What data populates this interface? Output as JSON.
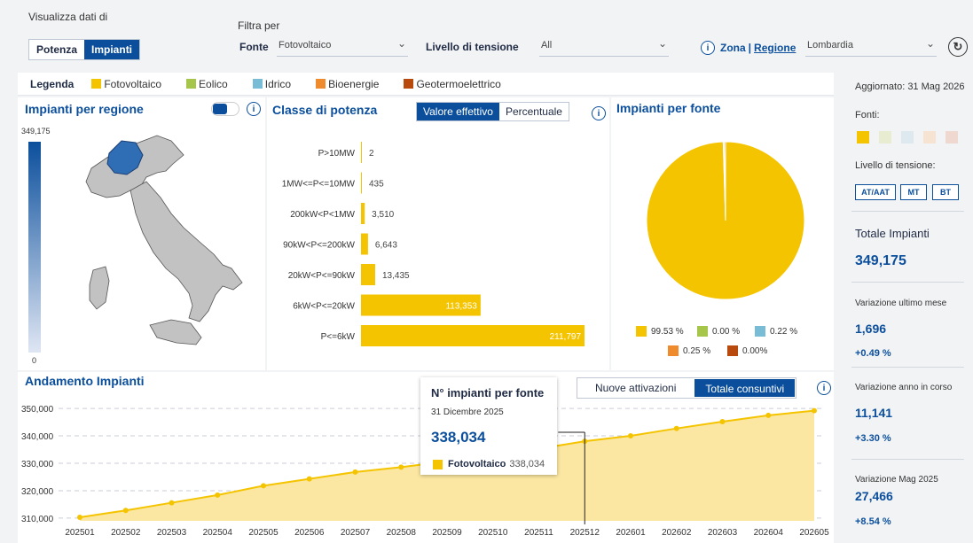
{
  "topbar": {
    "view_label": "Visualizza dati di",
    "view_options": [
      "Potenza",
      "Impianti"
    ],
    "filter_label": "Filtra per",
    "fonte_label": "Fonte",
    "fonte_value": "Fotovoltaico",
    "tensione_label": "Livello di tensione",
    "tensione_value": "All",
    "zona_label": "Zona",
    "regione_label": "Regione",
    "regione_value": "Lombardia"
  },
  "legend": {
    "title": "Legenda",
    "items": [
      {
        "label": "Fotovoltaico",
        "color": "#f5c400"
      },
      {
        "label": "Eolico",
        "color": "#a6c64b"
      },
      {
        "label": "Idrico",
        "color": "#79bcd6"
      },
      {
        "label": "Bioenergie",
        "color": "#ef8b2c"
      },
      {
        "label": "Geotermoelettrico",
        "color": "#b84a0e"
      }
    ]
  },
  "map_panel": {
    "title": "Impianti per regione",
    "scale_max": "349,175",
    "scale_min": "0"
  },
  "power_panel": {
    "title": "Classe di potenza",
    "toggle": [
      "Valore effettivo",
      "Percentuale"
    ]
  },
  "source_panel": {
    "title": "Impianti per fonte",
    "legend": [
      "99.53 %",
      "0.00 %",
      "0.22 %",
      "0.25 %",
      "0.00%"
    ]
  },
  "trend_panel": {
    "title": "Andamento Impianti",
    "toggle": [
      "Nuove attivazioni",
      "Totale consuntivi"
    ]
  },
  "tooltip": {
    "title": "N° impianti per fonte",
    "date": "31 Dicembre 2025",
    "value": "338,034",
    "series_label": "Fotovoltaico",
    "series_value": "338,034"
  },
  "sidebar": {
    "updated": "Aggiornato: 31 Mag 2026",
    "fonti_label": "Fonti:",
    "fonti_colors": [
      "#f5c400",
      "#e8ecd0",
      "#dde9ee",
      "#f7e3d2",
      "#eed8d0"
    ],
    "tensione_label": "Livello di tensione:",
    "tensione_buttons": [
      "AT/AAT",
      "MT",
      "BT"
    ],
    "total_label": "Totale Impianti",
    "total_value": "349,175",
    "month_label": "Variazione ultimo mese",
    "month_value": "1,696",
    "month_pct": "+0.49 %",
    "year_label": "Variazione anno in corso",
    "year_value": "11,141",
    "year_pct": "+3.30 %",
    "yoy_label": "Variazione Mag 2025",
    "yoy_value": "27,466",
    "yoy_pct": "+8.54 %"
  },
  "chart_data": [
    {
      "type": "bar",
      "orientation": "horizontal",
      "categories": [
        "P>10MW",
        "1MW<=P<=10MW",
        "200kW<P<1MW",
        "90kW<P<=200kW",
        "20kW<P<=90kW",
        "6kW<P<=20kW",
        "P<=6kW"
      ],
      "values": [
        2,
        435,
        3510,
        6643,
        13435,
        113353,
        211797
      ],
      "value_labels": [
        "2",
        "435",
        "3,510",
        "6,643",
        "13,435",
        "113,353",
        "211,797"
      ],
      "color": "#f5c400"
    },
    {
      "type": "pie",
      "labels": [
        "Fotovoltaico",
        "Eolico",
        "Idrico",
        "Bioenergie",
        "Geotermoelettrico"
      ],
      "values": [
        99.53,
        0.0,
        0.22,
        0.25,
        0.0
      ],
      "colors": [
        "#f5c400",
        "#a6c64b",
        "#79bcd6",
        "#ef8b2c",
        "#b84a0e"
      ]
    },
    {
      "type": "area",
      "x": [
        "202501",
        "202502",
        "202503",
        "202504",
        "202505",
        "202506",
        "202507",
        "202508",
        "202509",
        "202510",
        "202511",
        "202512",
        "202601",
        "202602",
        "202603",
        "202604",
        "202605"
      ],
      "values": [
        310300,
        312800,
        315600,
        318400,
        321800,
        324300,
        326800,
        328600,
        330700,
        332900,
        335300,
        338034,
        340000,
        342700,
        345200,
        347500,
        349175
      ],
      "yticks": [
        "350,000",
        "340,000",
        "330,000",
        "320,000",
        "310,000"
      ],
      "ytick_values": [
        350000,
        340000,
        330000,
        320000,
        310000
      ],
      "ylim": [
        309000,
        351000
      ],
      "grid": true,
      "color": "#f5c400"
    }
  ]
}
